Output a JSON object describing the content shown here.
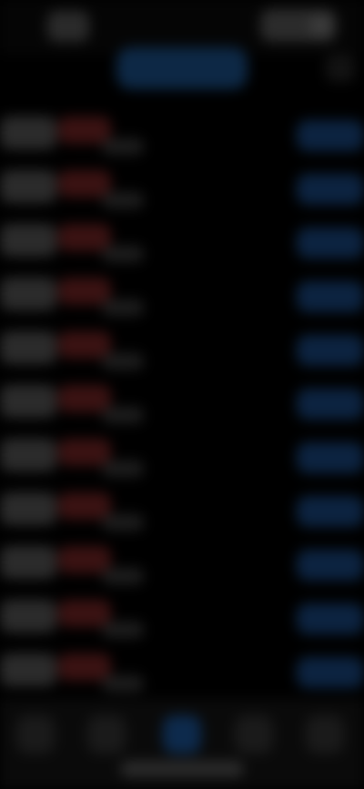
{
  "top_bar": {
    "left_button_icon": "back-icon",
    "right_button_icon": "avatar-icon"
  },
  "segment_control": {
    "active_color": "#0d2845"
  },
  "list": {
    "rows": [
      {},
      {},
      {},
      {},
      {},
      {},
      {},
      {},
      {},
      {},
      {}
    ],
    "accent_red": "#3a1212",
    "accent_blue": "#0c2340"
  },
  "tab_bar": {
    "tabs": [
      {
        "icon": "tab-1-icon"
      },
      {
        "icon": "tab-2-icon"
      },
      {
        "icon": "tab-3-icon",
        "active": true
      },
      {
        "icon": "tab-4-icon"
      },
      {
        "icon": "tab-5-icon"
      }
    ]
  }
}
